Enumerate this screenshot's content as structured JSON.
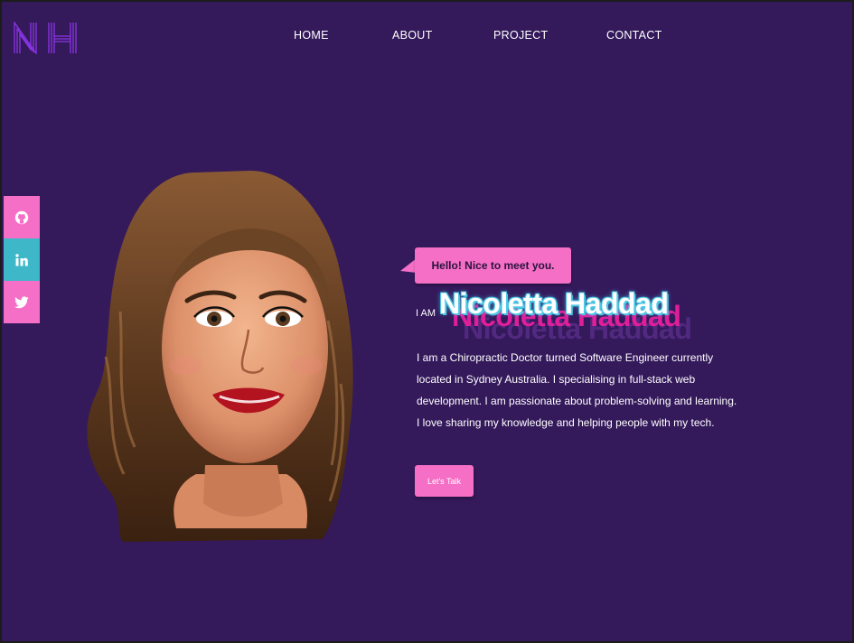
{
  "brand": {
    "logo_text": "NH",
    "accent": "#8a35e6"
  },
  "nav": {
    "items": [
      "HOME",
      "ABOUT",
      "PROJECT",
      "CONTACT"
    ]
  },
  "social": [
    {
      "icon": "github-icon",
      "color": "#f46fc5"
    },
    {
      "icon": "linkedin-icon",
      "color": "#3eb7c9"
    },
    {
      "icon": "twitter-icon",
      "color": "#f46fc5"
    }
  ],
  "hero": {
    "greeting": "Hello! Nice to meet you.",
    "i_am": "I AM",
    "name": "Nicoletta Haddad",
    "bio_lines": [
      "I am a Chiropractic Doctor turned Software Engineer currently",
      "located in Sydney Australia. I specialising in full-stack web",
      "development. I am passionate about problem-solving and learning.",
      "I love sharing my knowledge and helping people with my tech."
    ],
    "cta": "Let's Talk"
  },
  "colors": {
    "background": "#34195b",
    "pink": "#f46fc5",
    "teal": "#3eb7c9"
  }
}
